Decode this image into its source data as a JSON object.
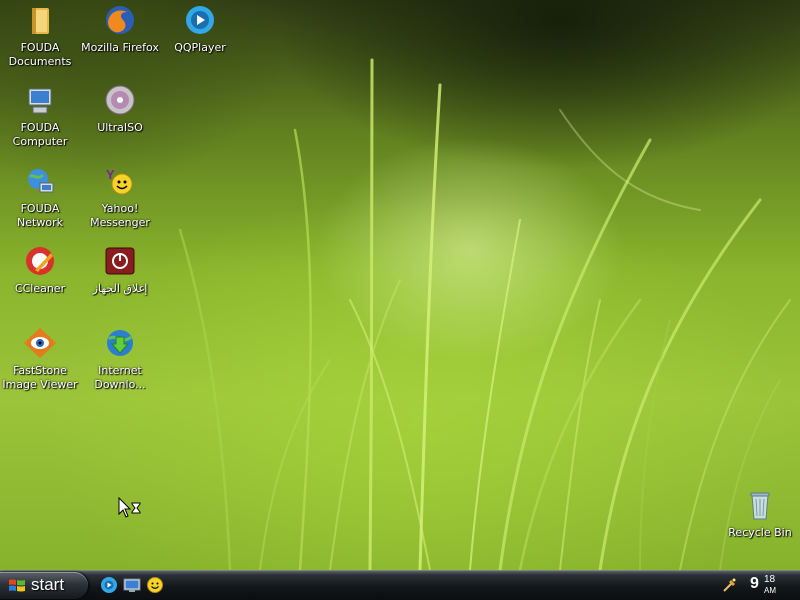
{
  "desktop_icons": [
    {
      "label": "FOUDA\nDocuments",
      "icon": "folder-icon"
    },
    {
      "label": "Mozilla Firefox",
      "icon": "firefox-icon"
    },
    {
      "label": "QQPlayer",
      "icon": "qqplayer-icon"
    },
    {
      "label": "FOUDA\nComputer",
      "icon": "computer-icon"
    },
    {
      "label": "UltraISO",
      "icon": "disc-icon"
    },
    {
      "label": "FOUDA\nNetwork",
      "icon": "network-icon"
    },
    {
      "label": "Yahoo!\nMessenger",
      "icon": "yahoo-messenger-icon"
    },
    {
      "label": "CCleaner",
      "icon": "ccleaner-icon"
    },
    {
      "label": "إغلاق الجهاز",
      "icon": "shutdown-icon"
    },
    {
      "label": "FastStone\nImage Viewer",
      "icon": "faststone-icon"
    },
    {
      "label": "Internet\nDownlo...",
      "icon": "internet-download-manager-icon"
    },
    {
      "label": "Recycle Bin",
      "icon": "recycle-bin-icon"
    }
  ],
  "taskbar": {
    "start_label": "start",
    "quick_launch": [
      "qqplayer-icon",
      "show-desktop-icon",
      "yahoo-messenger-icon"
    ],
    "tray_icons": [
      "tray-app-icon"
    ],
    "clock": {
      "hour": "9",
      "minutes": "18",
      "ampm": "AM"
    }
  },
  "colors": {
    "taskbar": "#14171a",
    "desktop_green": "#8ab52c"
  }
}
